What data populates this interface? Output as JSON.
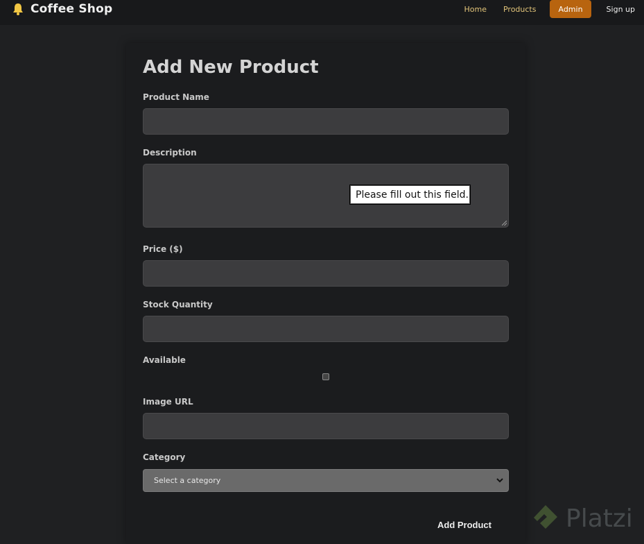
{
  "navbar": {
    "brand": "Coffee Shop",
    "links": [
      {
        "label": "Home"
      },
      {
        "label": "Products"
      },
      {
        "label": "Admin"
      },
      {
        "label": "Sign up"
      }
    ]
  },
  "form": {
    "title": "Add New Product",
    "fields": {
      "product_name": {
        "label": "Product Name",
        "value": ""
      },
      "description": {
        "label": "Description",
        "value": ""
      },
      "price": {
        "label": "Price ($)",
        "value": ""
      },
      "stock": {
        "label": "Stock Quantity",
        "value": ""
      },
      "available": {
        "label": "Available",
        "checked": false
      },
      "image_url": {
        "label": "Image URL",
        "value": ""
      },
      "category": {
        "label": "Category",
        "selected": "Select a category"
      }
    },
    "validation_tooltip": "Please fill out this field.",
    "submit_label": "Add Product"
  },
  "watermark": {
    "text": "Platzi"
  },
  "colors": {
    "accent": "#b8640f",
    "nav_link": "#e3c57a",
    "background": "#1f2022",
    "field_bg": "#3c3c3e"
  }
}
